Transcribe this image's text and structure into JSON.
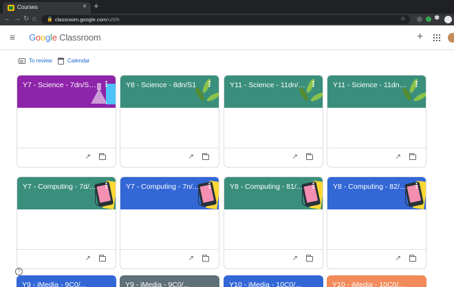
{
  "browser": {
    "tab_title": "Courses",
    "tab_close": "×",
    "new_tab": "+",
    "url_host": "classroom.google.com",
    "url_path": "/u/0/h"
  },
  "header": {
    "brand_google": [
      "G",
      "o",
      "o",
      "g",
      "l",
      "e"
    ],
    "brand_product": "Classroom"
  },
  "links": {
    "to_review": "To review",
    "calendar": "Calendar"
  },
  "cards": [
    {
      "title": "Y7 - Science - 7dn/S1...",
      "color": "#8e24aa",
      "art": "science-purple"
    },
    {
      "title": "Y8 - Science - 8dn/S1",
      "color": "#3a8f7c",
      "art": "science-green"
    },
    {
      "title": "Y11 - Science - 11dn/S...",
      "color": "#3a8f7c",
      "art": "science-green"
    },
    {
      "title": "Y11 - Science - 11dnS1...",
      "color": "#3a8f7c",
      "art": "science-green"
    },
    {
      "title": "Y7 - Computing - 7d/...",
      "color": "#3a8f7c",
      "art": "computing"
    },
    {
      "title": "Y7 - Computing - 7n/...",
      "color": "#3367d6",
      "art": "computing"
    },
    {
      "title": "Y8 - Computing - 81/...",
      "color": "#3a8f7c",
      "art": "computing"
    },
    {
      "title": "Y8 - Computing - 82/...",
      "color": "#3367d6",
      "art": "computing"
    }
  ],
  "partial_cards": [
    {
      "title": "Y9 - iMedia - 9C0/...",
      "color": "#3367d6"
    },
    {
      "title": "Y9 - iMedia - 9C0/...",
      "color": "#5f7079"
    },
    {
      "title": "Y10 - iMedia - 10C0/...",
      "color": "#3367d6"
    },
    {
      "title": "Y10 - iMedia - 10C0/...",
      "color": "#f28b5b"
    }
  ],
  "icons": {
    "menu": "≡",
    "plus": "+",
    "more": "⋮",
    "trend": "↗",
    "help": "?"
  }
}
